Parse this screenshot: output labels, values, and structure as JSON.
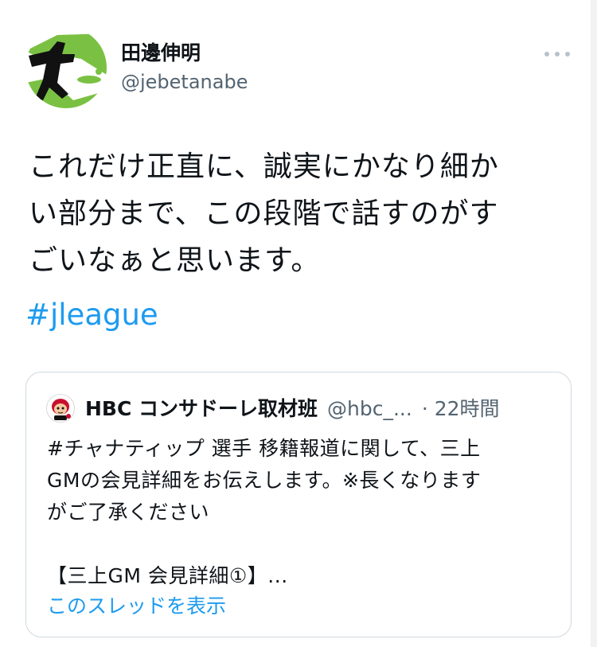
{
  "tweet": {
    "author": {
      "name": "田邊伸明",
      "handle": "@jebetanabe",
      "avatar_icon": "team-logo-avatar"
    },
    "more_icon": "more-horizontal-icon",
    "text_lines": [
      "これだけ正直に、誠実にかなり細か",
      "い部分まで、この段階で話すのがす",
      "ごいなぁと思います。"
    ],
    "hashtag": "#jleague"
  },
  "quote": {
    "avatar_icon": "mascot-avatar",
    "name": "HBC コンサドーレ取材班",
    "handle": "@hbc_...",
    "time": "· 22時間",
    "text_lines": [
      "#チャナティップ 選手 移籍報道に関して、三上",
      "GMの会見詳細をお伝えします。※長くなります",
      "がご了承ください",
      "",
      "【三上GM 会見詳細①】..."
    ],
    "show_thread": "このスレッドを表示"
  },
  "colors": {
    "link": "#1d9bf0",
    "secondary_text": "#536471",
    "border": "#cfd9de",
    "avatar_green": "#7ac143"
  }
}
